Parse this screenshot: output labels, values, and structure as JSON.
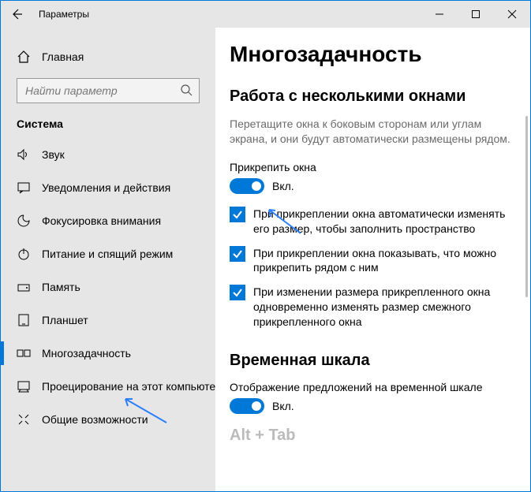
{
  "window": {
    "title": "Параметры"
  },
  "sidebar": {
    "home": "Главная",
    "search_placeholder": "Найти параметр",
    "category": "Система",
    "items": [
      {
        "label": "Звук"
      },
      {
        "label": "Уведомления и действия"
      },
      {
        "label": "Фокусировка внимания"
      },
      {
        "label": "Питание и спящий режим"
      },
      {
        "label": "Память"
      },
      {
        "label": "Планшет"
      },
      {
        "label": "Многозадачность"
      },
      {
        "label": "Проецирование на этот компьютер"
      },
      {
        "label": "Общие возможности"
      }
    ]
  },
  "content": {
    "title": "Многозадачность",
    "section1": {
      "heading": "Работа с несколькими окнами",
      "description": "Перетащите окна к боковым сторонам или углам экрана, и они будут автоматически размещены рядом.",
      "snap_label": "Прикрепить окна",
      "toggle_state": "Вкл.",
      "checks": [
        "При прикреплении окна автоматически изменять его размер, чтобы заполнить пространство",
        "При прикреплении окна показывать, что можно прикрепить рядом с ним",
        "При изменении размера прикрепленного окна одновременно изменять размер смежного прикрепленного окна"
      ]
    },
    "section2": {
      "heading": "Временная шкала",
      "label": "Отображение предложений на временной шкале",
      "toggle_state": "Вкл."
    },
    "section3_peek": "Alt + Tab"
  }
}
